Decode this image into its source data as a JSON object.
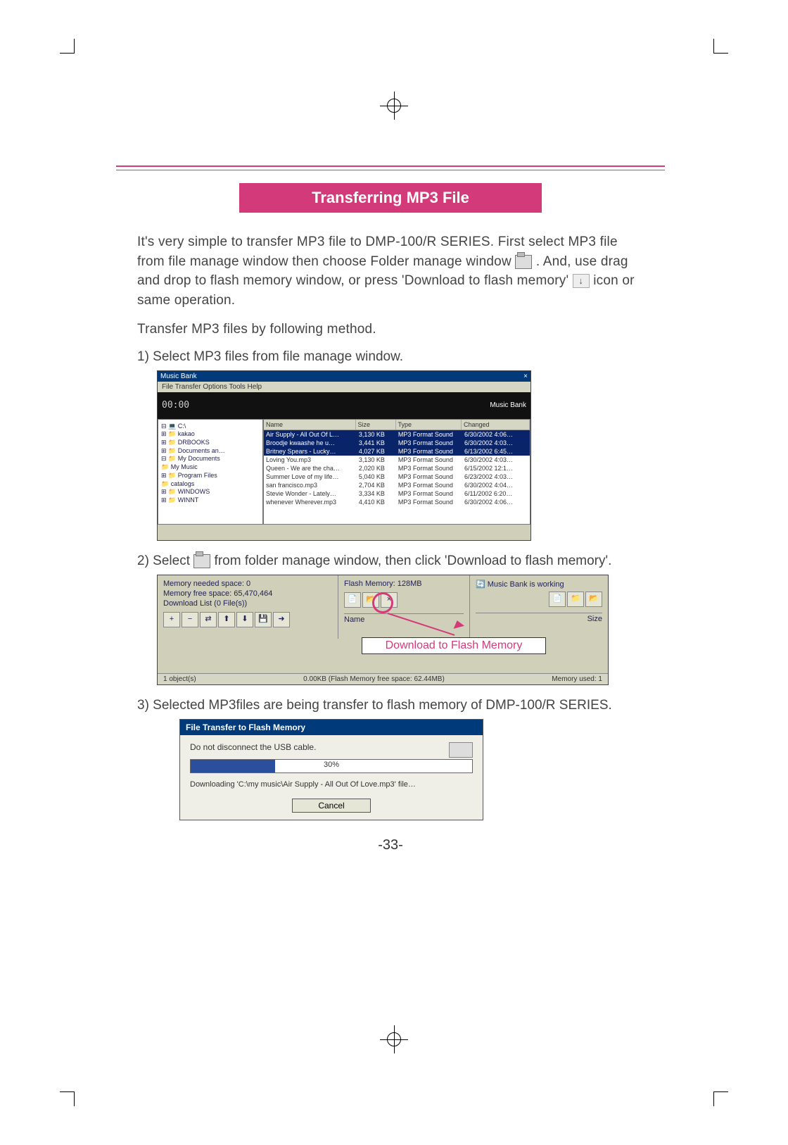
{
  "page_number": "-33-",
  "heading": "Transferring MP3 File",
  "intro": {
    "line1a": "It's very simple to transfer MP3 file to DMP-100/R SERIES. First select MP3 file from file manage window then choose Folder manage window ",
    "line1b": " . And, use drag and drop to flash memory window, or press 'Download to flash memory' ",
    "line1c": " icon or same operation.",
    "line2": "Transfer MP3 files by following method."
  },
  "steps": {
    "s1": "1) Select MP3 files from file manage window.",
    "s2a": "2) Select ",
    "s2b": " from folder manage window, then click 'Download to flash memory'.",
    "s3": "3) Selected MP3files are being transfer to flash memory of DMP-100/R SERIES."
  },
  "screenshot1": {
    "window_title": "Music Bank",
    "window_controls": "×",
    "menu": "File  Transfer  Options  Tools  Help",
    "time": "00:00",
    "brand": "Music Bank",
    "tree": [
      "⊟ 💻 C:\\",
      "  ⊞ 📁 kakao",
      "  ⊞ 📁 DRBOOKS",
      "  ⊞ 📁 Documents an…",
      "  ⊟ 📁 My Documents",
      "    📁 My Music",
      "  ⊞ 📁 Program Files",
      "    📁 catalogs",
      "  ⊞ 📁 WINDOWS",
      "  ⊞ 📁 WINNT"
    ],
    "list_headers": {
      "name": "Name",
      "size": "Size",
      "type": "Type",
      "changed": "Changed"
    },
    "rows": [
      {
        "name": "Air Supply - All Out Of L…",
        "size": "3,130 KB",
        "type": "MP3 Format Sound",
        "changed": "6/30/2002 4:06…",
        "sel": true
      },
      {
        "name": "Broodje kwaashe he u…",
        "size": "3,441 KB",
        "type": "MP3 Format Sound",
        "changed": "6/30/2002 4:03…",
        "sel": true
      },
      {
        "name": "Britney Spears - Lucky…",
        "size": "4,027 KB",
        "type": "MP3 Format Sound",
        "changed": "6/13/2002 6:45…",
        "sel": true
      },
      {
        "name": "Loving You.mp3",
        "size": "3,130 KB",
        "type": "MP3 Format Sound",
        "changed": "6/30/2002 4:03…"
      },
      {
        "name": "Queen - We are the cha…",
        "size": "2,020 KB",
        "type": "MP3 Format Sound",
        "changed": "6/15/2002 12:1…"
      },
      {
        "name": "Summer Love of my life…",
        "size": "5,040 KB",
        "type": "MP3 Format Sound",
        "changed": "6/23/2002 4:03…"
      },
      {
        "name": "san francisco.mp3",
        "size": "2,704 KB",
        "type": "MP3 Format Sound",
        "changed": "6/30/2002 4:04…"
      },
      {
        "name": "Stevie Wonder - Lately…",
        "size": "3,334 KB",
        "type": "MP3 Format Sound",
        "changed": "6/11/2002 6:20…"
      },
      {
        "name": "whenever Wherever.mp3",
        "size": "4,410 KB",
        "type": "MP3 Format Sound",
        "changed": "6/30/2002 4:06…"
      }
    ]
  },
  "screenshot2": {
    "left_line1": "Memory needed space: 0",
    "left_line2a": "Memory free space:",
    "left_line2b": "65,470,464",
    "left_line3": "Download List (0 File(s))",
    "toolbar_btns": [
      "+",
      "−",
      "⇄",
      "⬆",
      "⬇",
      "💾",
      "➜"
    ],
    "mid_title": "Flash Memory: 128MB",
    "mid_toolbar": [
      "📄",
      "📂",
      "×"
    ],
    "mid_col_name": "Name",
    "right_title": "🔄 Music Bank is working",
    "right_col": "Size",
    "callout_label": "Download to Flash Memory",
    "status_left": "1 object(s)",
    "status_mid": "0.00KB (Flash Memory free space: 62.44MB)",
    "status_right": "Memory used: 1"
  },
  "screenshot3": {
    "title": "File Transfer to Flash Memory",
    "warning": "Do not disconnect the USB cable.",
    "progress_pct": "30%",
    "path": "Downloading 'C:\\my music\\Air Supply - All Out Of Love.mp3' file…",
    "cancel": "Cancel"
  }
}
